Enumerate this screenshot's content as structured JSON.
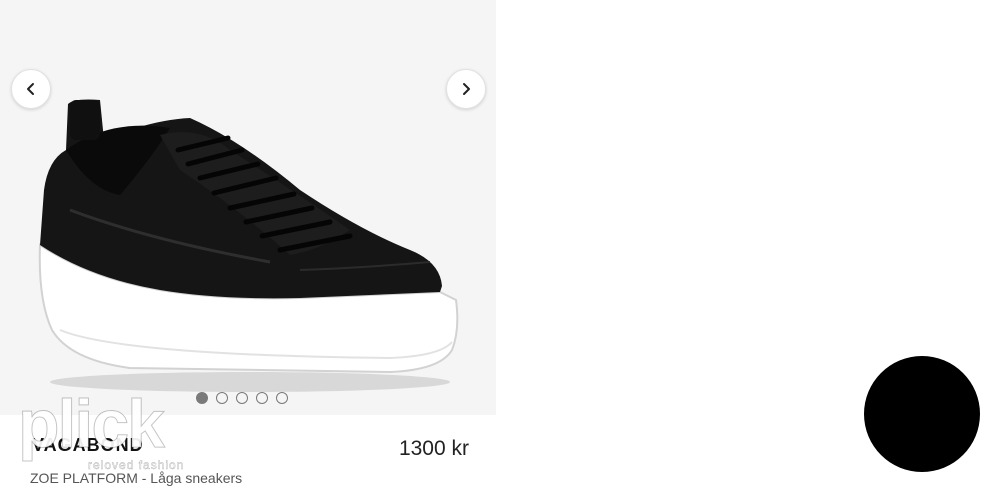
{
  "product": {
    "brand": "VAGABOND",
    "name": "ZOE PLATFORM - Låga sneakers",
    "price": "1300 kr"
  },
  "gallery": {
    "image_count": 5,
    "active_index": 0,
    "prev_icon": "chevron-left-icon",
    "next_icon": "chevron-right-icon"
  },
  "watermark": {
    "word": "plick",
    "tagline": "reloved fashion"
  },
  "colors": {
    "gallery_bg": "#f5f5f5",
    "shoe_upper": "#111111",
    "sole": "#ffffff",
    "fab": "#000000"
  }
}
